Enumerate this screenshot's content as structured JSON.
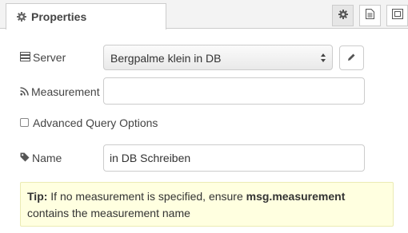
{
  "tabs": {
    "properties_label": "Properties"
  },
  "form": {
    "server": {
      "label": "Server",
      "selected": "Bergpalme klein in DB"
    },
    "measurement": {
      "label": "Measurement",
      "value": ""
    },
    "advanced": {
      "label": "Advanced Query Options",
      "checked": false
    },
    "name": {
      "label": "Name",
      "value": "in DB Schreiben"
    }
  },
  "tip": {
    "prefix": "Tip:",
    "text1": " If no measurement is specified, ensure ",
    "code": "msg.measurement",
    "text2": " contains the measurement name"
  },
  "icons": {
    "tab": "gear-icon",
    "toolbar": [
      "gear-icon",
      "document-icon",
      "frame-icon"
    ],
    "server": "server-icon",
    "measurement": "rss-icon",
    "name": "tag-icon",
    "edit": "pencil-icon"
  }
}
